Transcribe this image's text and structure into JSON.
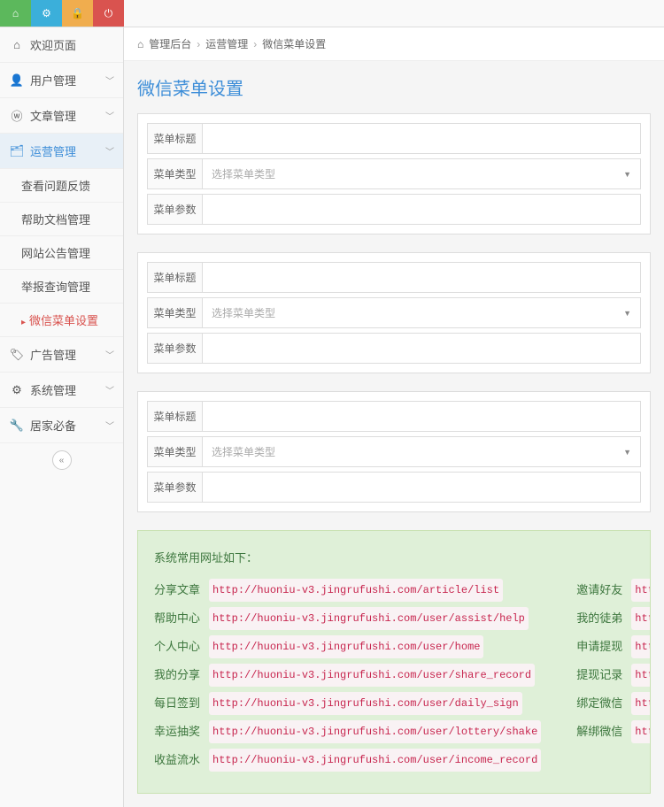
{
  "breadcrumb": {
    "icon": "⌂",
    "p1": "管理后台",
    "p2": "运营管理",
    "p3": "微信菜单设置"
  },
  "pageTitle": "微信菜单设置",
  "sidebar": {
    "items": [
      {
        "icon": "⌂",
        "label": "欢迎页面"
      },
      {
        "icon": "👤",
        "label": "用户管理"
      },
      {
        "icon": "ⓦ",
        "label": "文章管理"
      },
      {
        "icon": "🗂",
        "label": "运营管理"
      },
      {
        "icon": "🏷",
        "label": "广告管理"
      },
      {
        "icon": "⚙",
        "label": "系统管理"
      },
      {
        "icon": "🔧",
        "label": "居家必备"
      }
    ],
    "subs": [
      {
        "label": "查看问题反馈"
      },
      {
        "label": "帮助文档管理"
      },
      {
        "label": "网站公告管理"
      },
      {
        "label": "举报查询管理"
      },
      {
        "label": "微信菜单设置"
      }
    ]
  },
  "form": {
    "label_title": "菜单标题",
    "label_type": "菜单类型",
    "label_param": "菜单参数",
    "type_placeholder": "选择菜单类型"
  },
  "greenbox": {
    "heading": "系统常用网址如下：",
    "left": [
      {
        "name": "分享文章",
        "url": "http://huoniu-v3.jingrufushi.com/article/list"
      },
      {
        "name": "帮助中心",
        "url": "http://huoniu-v3.jingrufushi.com/user/assist/help"
      },
      {
        "name": "个人中心",
        "url": "http://huoniu-v3.jingrufushi.com/user/home"
      },
      {
        "name": "我的分享",
        "url": "http://huoniu-v3.jingrufushi.com/user/share_record"
      },
      {
        "name": "每日签到",
        "url": "http://huoniu-v3.jingrufushi.com/user/daily_sign"
      },
      {
        "name": "幸运抽奖",
        "url": "http://huoniu-v3.jingrufushi.com/user/lottery/shake"
      },
      {
        "name": "收益流水",
        "url": "http://huoniu-v3.jingrufushi.com/user/income_record"
      }
    ],
    "right": [
      {
        "name": "邀请好友",
        "url": "http:"
      },
      {
        "name": "我的徒弟",
        "url": "http:"
      },
      {
        "name": "申请提现",
        "url": "http:"
      },
      {
        "name": "提现记录",
        "url": "http:"
      },
      {
        "name": "绑定微信",
        "url": "http:"
      },
      {
        "name": "解绑微信",
        "url": "http:"
      }
    ]
  }
}
